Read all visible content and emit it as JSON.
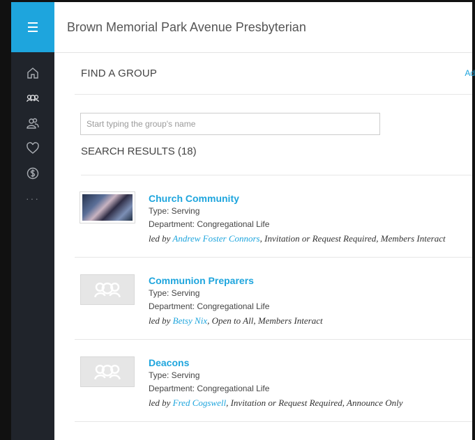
{
  "church": {
    "name": "Brown Memorial Park Avenue Presbyterian"
  },
  "nav": {
    "items": [
      {
        "icon": "home-icon"
      },
      {
        "icon": "groups-icon"
      },
      {
        "icon": "people-icon"
      },
      {
        "icon": "heart-icon"
      },
      {
        "icon": "dollar-icon"
      },
      {
        "icon": "more-icon",
        "label": "···"
      }
    ]
  },
  "find_group": {
    "title": "FIND A GROUP",
    "add_link": "Ad",
    "search": {
      "placeholder": "Start typing the group's name",
      "value": ""
    }
  },
  "results": {
    "title": "SEARCH RESULTS (18)",
    "items": [
      {
        "name": "Church Community",
        "type": "Type: Serving",
        "department": "Department: Congregational Life",
        "led_by": "led by ",
        "leader": "Andrew Foster Connors",
        "details": ", Invitation or Request Required, Members Interact",
        "thumbnail": "photo"
      },
      {
        "name": "Communion Preparers",
        "type": "Type: Serving",
        "department": "Department: Congregational Life",
        "led_by": "led by ",
        "leader": "Betsy Nix",
        "details": ", Open to All, Members Interact",
        "thumbnail": "groups-icon"
      },
      {
        "name": "Deacons",
        "type": "Type: Serving",
        "department": "Department: Congregational Life",
        "led_by": "led by ",
        "leader": "Fred Cogswell",
        "details": ", Invitation or Request Required, Announce Only",
        "thumbnail": "groups-icon"
      }
    ]
  },
  "colors": {
    "accent": "#1ea5dd",
    "sidebar": "#20242b"
  }
}
